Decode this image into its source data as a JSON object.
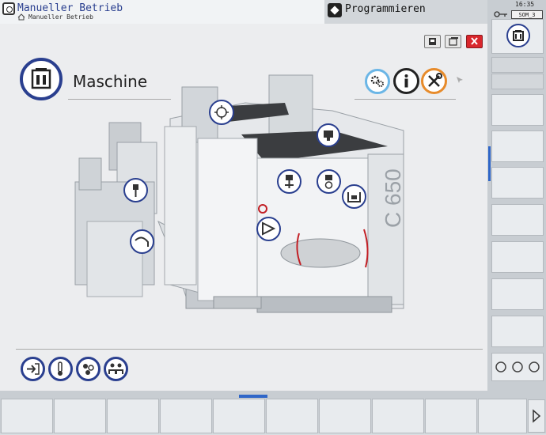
{
  "header": {
    "mode_title": "Manueller Betrieb",
    "mode_subtitle": "Manueller Betrieb",
    "program_label": "Programmieren"
  },
  "status": {
    "time": "16:35",
    "badge": "SOM_3"
  },
  "window_buttons": [
    {
      "icon": "print-icon"
    },
    {
      "icon": "window-icon"
    },
    {
      "icon": "close-icon"
    }
  ],
  "main": {
    "title": "Maschine",
    "top_icons": [
      "gears-icon",
      "info-icon",
      "tools-icon"
    ],
    "machine_label": "C 650",
    "hotspots": [
      "spindle-icon",
      "tool-magazine-icon",
      "coolant-icon",
      "chip-conveyor-icon",
      "axis-icon",
      "probe-icon",
      "table-icon",
      "tool-changer-icon",
      "measure-icon"
    ],
    "bottom_icons": [
      "login-icon",
      "thermometer-icon",
      "service-icon",
      "users-icon"
    ]
  },
  "colors": {
    "accent": "#2f66c8",
    "title_blue": "#2a3f8f",
    "close_red": "#d9262c",
    "icon_orange": "#e78b2b"
  }
}
